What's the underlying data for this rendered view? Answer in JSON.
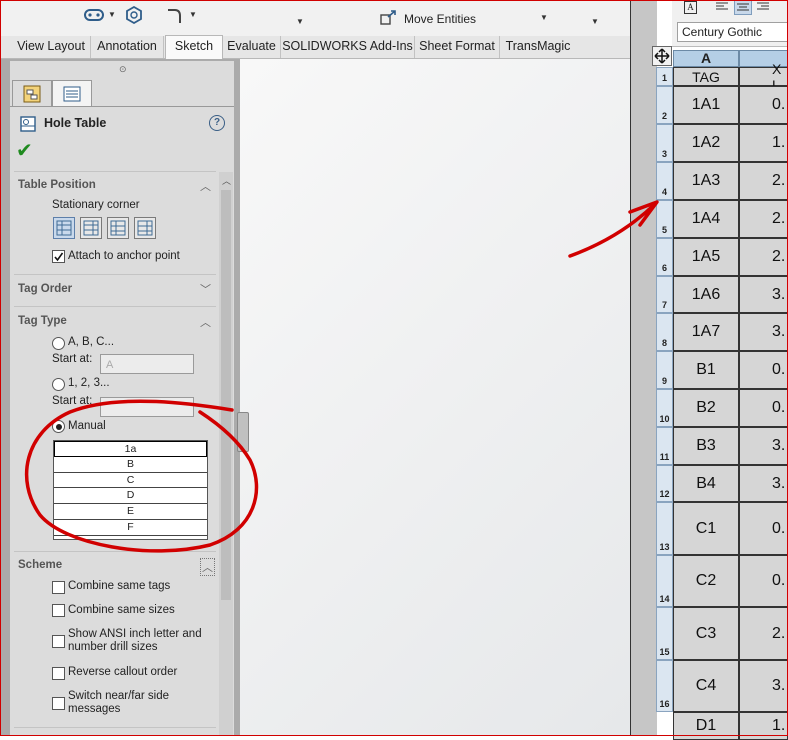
{
  "ribbon": {
    "move_entities": "Move Entities"
  },
  "tabs": [
    "View Layout",
    "Annotation",
    "Sketch",
    "Evaluate",
    "SOLIDWORKS Add-Ins",
    "Sheet Format",
    "TransMagic"
  ],
  "active_tab": "Sketch",
  "property_manager": {
    "title": "Hole Table",
    "table_position": {
      "header": "Table Position",
      "stationary_corner_label": "Stationary corner",
      "attach_label": "Attach to anchor point",
      "attach_checked": true
    },
    "tag_order": {
      "header": "Tag Order"
    },
    "tag_type": {
      "header": "Tag Type",
      "option_alpha": "A, B, C...",
      "start_at_label": "Start at:",
      "start_at_alpha_value": "A",
      "option_numeric": "1, 2, 3...",
      "start_at_label_2": "Start at:",
      "option_manual": "Manual",
      "selected": "Manual",
      "manual_tags": [
        "1a",
        "B",
        "C",
        "D",
        "E",
        "F"
      ]
    },
    "scheme": {
      "header": "Scheme",
      "options": [
        "Combine same tags",
        "Combine same sizes",
        "Show ANSI inch letter and number drill sizes",
        "Reverse callout order",
        "Switch near/far side messages"
      ]
    }
  },
  "format_toolbar": {
    "font": "Century Gothic"
  },
  "table": {
    "column_headers": [
      "A",
      ""
    ],
    "header_row": {
      "tag": "TAG",
      "xl": "X L"
    },
    "row_numbers": [
      "1",
      "2",
      "3",
      "4",
      "5",
      "6",
      "7",
      "8",
      "9",
      "10",
      "11",
      "12",
      "13",
      "14",
      "15",
      "16"
    ],
    "rows": [
      {
        "tag": "1A1",
        "xl": "0."
      },
      {
        "tag": "1A2",
        "xl": "1."
      },
      {
        "tag": "1A3",
        "xl": "2."
      },
      {
        "tag": "1A4",
        "xl": "2."
      },
      {
        "tag": "1A5",
        "xl": "2."
      },
      {
        "tag": "1A6",
        "xl": "3."
      },
      {
        "tag": "1A7",
        "xl": "3."
      },
      {
        "tag": "B1",
        "xl": "0."
      },
      {
        "tag": "B2",
        "xl": "0."
      },
      {
        "tag": "B3",
        "xl": "3."
      },
      {
        "tag": "B4",
        "xl": "3."
      },
      {
        "tag": "C1",
        "xl": "0."
      },
      {
        "tag": "C2",
        "xl": "0."
      },
      {
        "tag": "C3",
        "xl": "2."
      },
      {
        "tag": "C4",
        "xl": "3."
      },
      {
        "tag": "D1",
        "xl": "1."
      }
    ]
  },
  "colors": {
    "annotation": "#d10000",
    "panel": "#dcdcdc",
    "table_cell": "#d6d6d6",
    "column_header": "#b5cfe6"
  }
}
